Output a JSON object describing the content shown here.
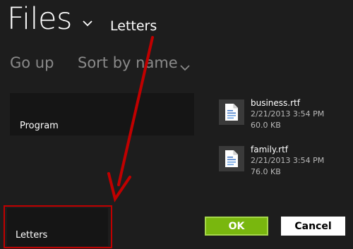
{
  "header": {
    "title": "Files",
    "current_folder": "Letters"
  },
  "toolbar": {
    "go_up": "Go up",
    "sort_by": "Sort by name"
  },
  "folders": [
    {
      "name": "Program"
    },
    {
      "name": "Letters"
    }
  ],
  "files": [
    {
      "name": "business.rtf",
      "date": "2/21/2013 3:54 PM",
      "size": "60.0 KB",
      "icon": "rtf-document-icon"
    },
    {
      "name": "family.rtf",
      "date": "2/21/2013 3:54 PM",
      "size": "76.0 KB",
      "icon": "rtf-document-icon"
    }
  ],
  "buttons": {
    "ok": "OK",
    "cancel": "Cancel"
  },
  "annotation": {
    "color": "#c00000"
  },
  "colors": {
    "background": "#1d1d1d",
    "ok_button": "#79b70e",
    "cancel_button": "#ffffff"
  }
}
